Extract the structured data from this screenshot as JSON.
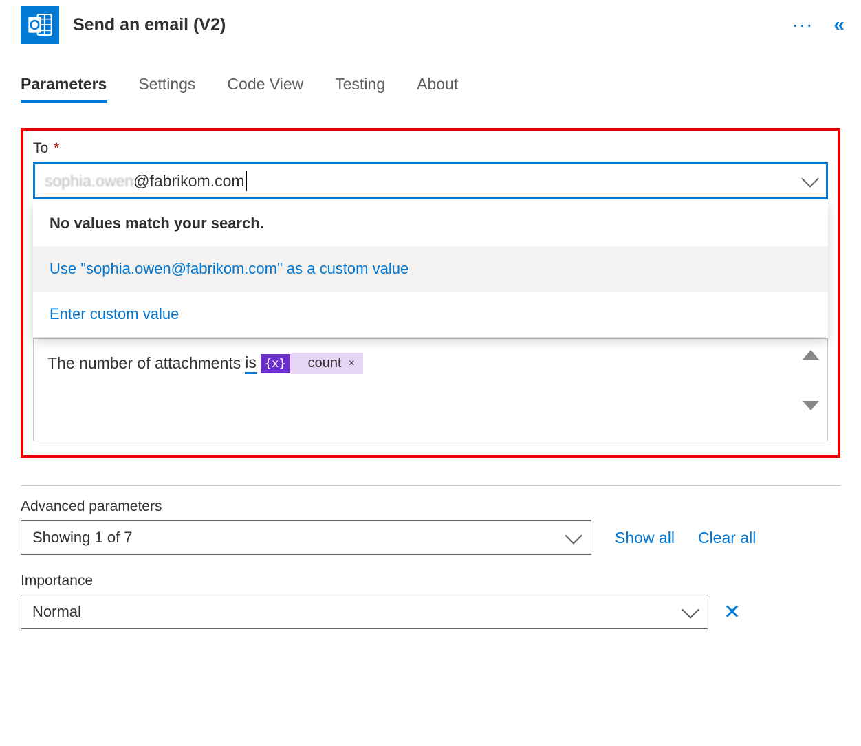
{
  "header": {
    "title": "Send an email (V2)"
  },
  "tabs": {
    "items": [
      {
        "label": "Parameters",
        "active": true
      },
      {
        "label": "Settings",
        "active": false
      },
      {
        "label": "Code View",
        "active": false
      },
      {
        "label": "Testing",
        "active": false
      },
      {
        "label": "About",
        "active": false
      }
    ]
  },
  "to_field": {
    "label": "To",
    "value_blurred": "sophia.owen",
    "value_suffix": "@fabrikom.com"
  },
  "dropdown": {
    "no_match": "No values match your search.",
    "use_custom": "Use \"sophia.owen@fabrikom.com\" as a custom value",
    "enter_custom": "Enter custom value"
  },
  "body": {
    "prefix": "The number of attachments",
    "underlined": "is",
    "fx": "{x}",
    "token_label": "count"
  },
  "advanced": {
    "heading": "Advanced parameters",
    "showing": "Showing 1 of 7",
    "show_all": "Show all",
    "clear_all": "Clear all"
  },
  "importance": {
    "label": "Importance",
    "value": "Normal"
  }
}
